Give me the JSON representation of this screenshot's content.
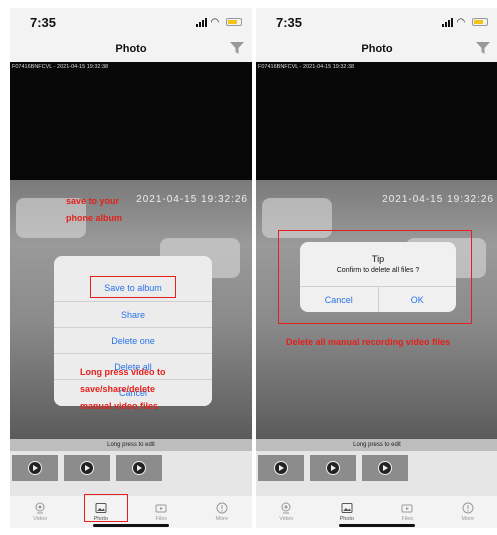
{
  "left": {
    "status_time": "7:35",
    "title": "Photo",
    "camera_label": "F07416BNFCVL - 2021-04-15 19:32:38",
    "overlay_time": "2021-04-15 19:32:26",
    "action_sheet": [
      "Save to album",
      "Share",
      "Delete one",
      "Delete all",
      "Cancel"
    ],
    "annotation_top": [
      "save to your",
      "phone album"
    ],
    "annotation_bottom": [
      "Long press video to",
      "save/share/delete",
      "manual video files"
    ],
    "edit_hint": "Long press to edit",
    "tabs": [
      "Video",
      "Photo",
      "Files",
      "More"
    ]
  },
  "right": {
    "status_time": "7:35",
    "title": "Photo",
    "camera_label": "F07416BNFCVL - 2021-04-15 19:32:38",
    "overlay_time": "2021-04-15 19:32:26",
    "dialog": {
      "title": "Tip",
      "message": "Confirm to delete all files ?",
      "cancel": "Cancel",
      "ok": "OK"
    },
    "annotation": "Delete all manual recording video files",
    "edit_hint": "Long press to edit",
    "tabs": [
      "Video",
      "Photo",
      "Files",
      "More"
    ]
  },
  "colors": {
    "annotation_red": "#e3211c",
    "ios_blue": "#2a73e8"
  }
}
